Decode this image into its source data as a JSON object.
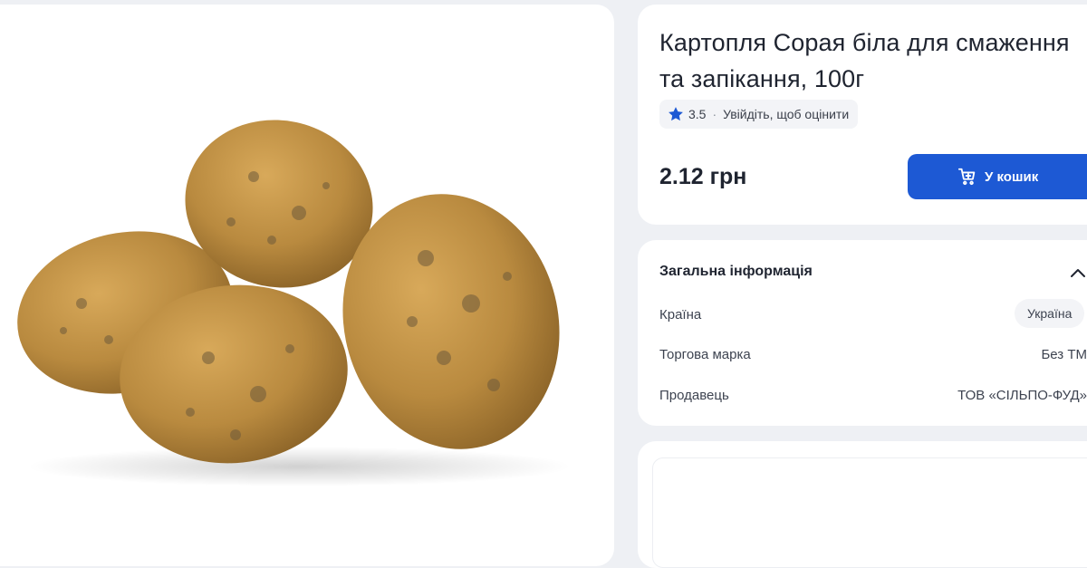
{
  "product": {
    "title": "Картопля Сорая біла для смаження та запікання, 100г",
    "rating_value": "3.5",
    "rating_separator": "·",
    "rating_cta": "Увійдіть, щоб оцінити",
    "price": "2.12 грн",
    "add_to_cart_label": "У кошик",
    "image_icon": "potato-product-photo"
  },
  "general_info": {
    "heading": "Загальна інформація",
    "toggle_icon": "chevron-up-icon",
    "rows": [
      {
        "label": "Країна",
        "value": "Україна"
      },
      {
        "label": "Торгова марка",
        "value": "Без ТМ"
      },
      {
        "label": "Продавець",
        "value": "ТОВ «СІЛЬПО-ФУД»"
      }
    ]
  },
  "colors": {
    "accent": "#1d59d4",
    "rating_star": "#1d59d4",
    "background": "#eef0f4"
  }
}
